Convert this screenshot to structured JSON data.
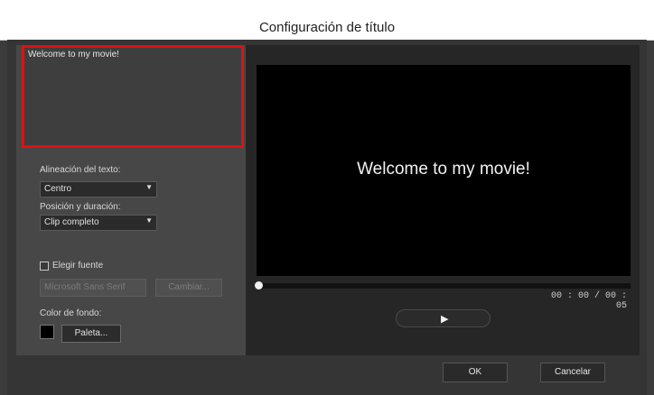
{
  "window": {
    "title": "Configuración de título"
  },
  "editor": {
    "text": "Welcome to my movie!"
  },
  "alignment": {
    "label": "Alineación del texto:",
    "value": "Centro"
  },
  "position": {
    "label": "Posición y duración:",
    "value": "Clip completo"
  },
  "font": {
    "checkbox_label": "Elegir fuente",
    "value": "Microsoft Sans Serif",
    "change_label": "Cambiar..."
  },
  "background": {
    "label": "Color de fondo:",
    "palette_label": "Paleta...",
    "color": "#000000"
  },
  "preview": {
    "text": "Welcome to my movie!",
    "time": "00 : 00 / 00 : 05",
    "progress": 0
  },
  "footer": {
    "ok_label": "OK",
    "cancel_label": "Cancelar"
  },
  "colors": {
    "highlight": "#e01010",
    "background": "#3b3b3b"
  },
  "icons": {
    "play": "play-icon",
    "dropdown": "chevron-down-icon"
  }
}
